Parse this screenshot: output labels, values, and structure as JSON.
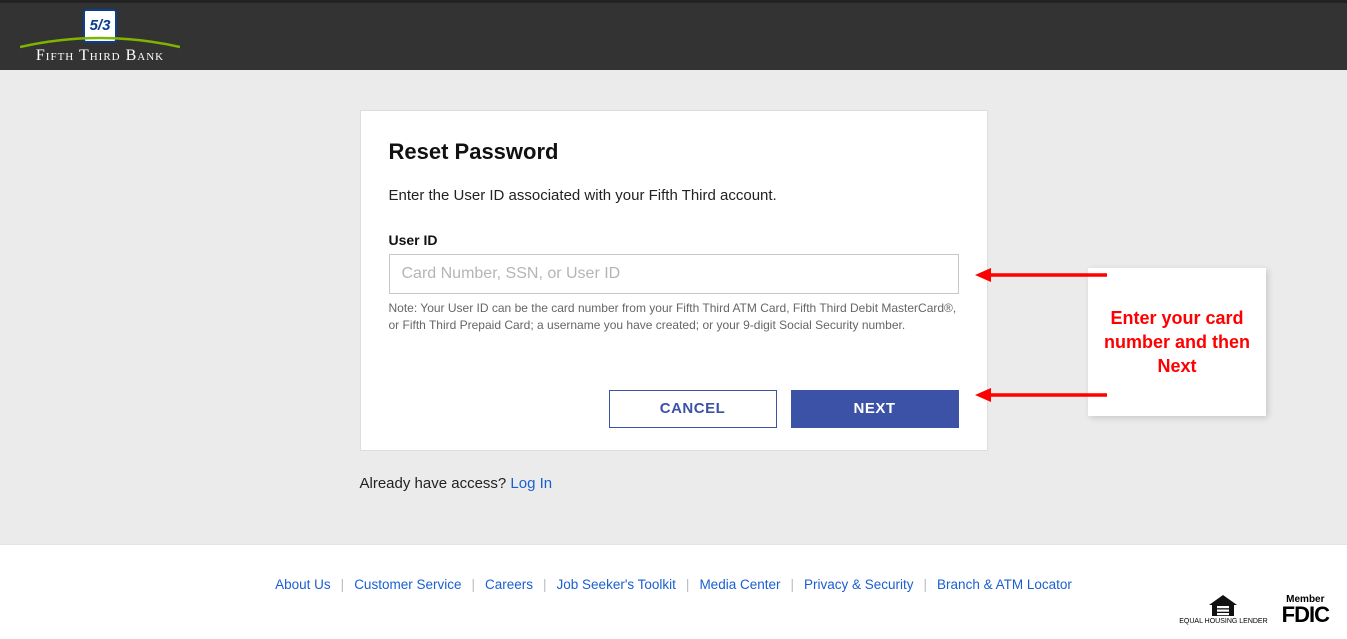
{
  "header": {
    "bank_name": "Fifth Third Bank"
  },
  "card": {
    "title": "Reset Password",
    "instruction": "Enter the User ID associated with your Fifth Third account.",
    "field_label": "User ID",
    "placeholder": "Card Number, SSN, or User ID",
    "note": "Note: Your User ID can be the card number from your Fifth Third ATM Card, Fifth Third Debit MasterCard®, or Fifth Third Prepaid Card; a username you have created; or your 9-digit Social Security number.",
    "cancel_label": "CANCEL",
    "next_label": "NEXT"
  },
  "below": {
    "already_text": "Already have access? ",
    "login_link": "Log In"
  },
  "annotation": {
    "text": "Enter your card number and then Next"
  },
  "footer": {
    "links": [
      "About Us",
      "Customer Service",
      "Careers",
      "Job Seeker's Toolkit",
      "Media Center",
      "Privacy & Security",
      "Branch & ATM Locator"
    ],
    "lender_text": "EQUAL HOUSING LENDER",
    "fdic_member": "Member",
    "fdic": "FDIC"
  }
}
